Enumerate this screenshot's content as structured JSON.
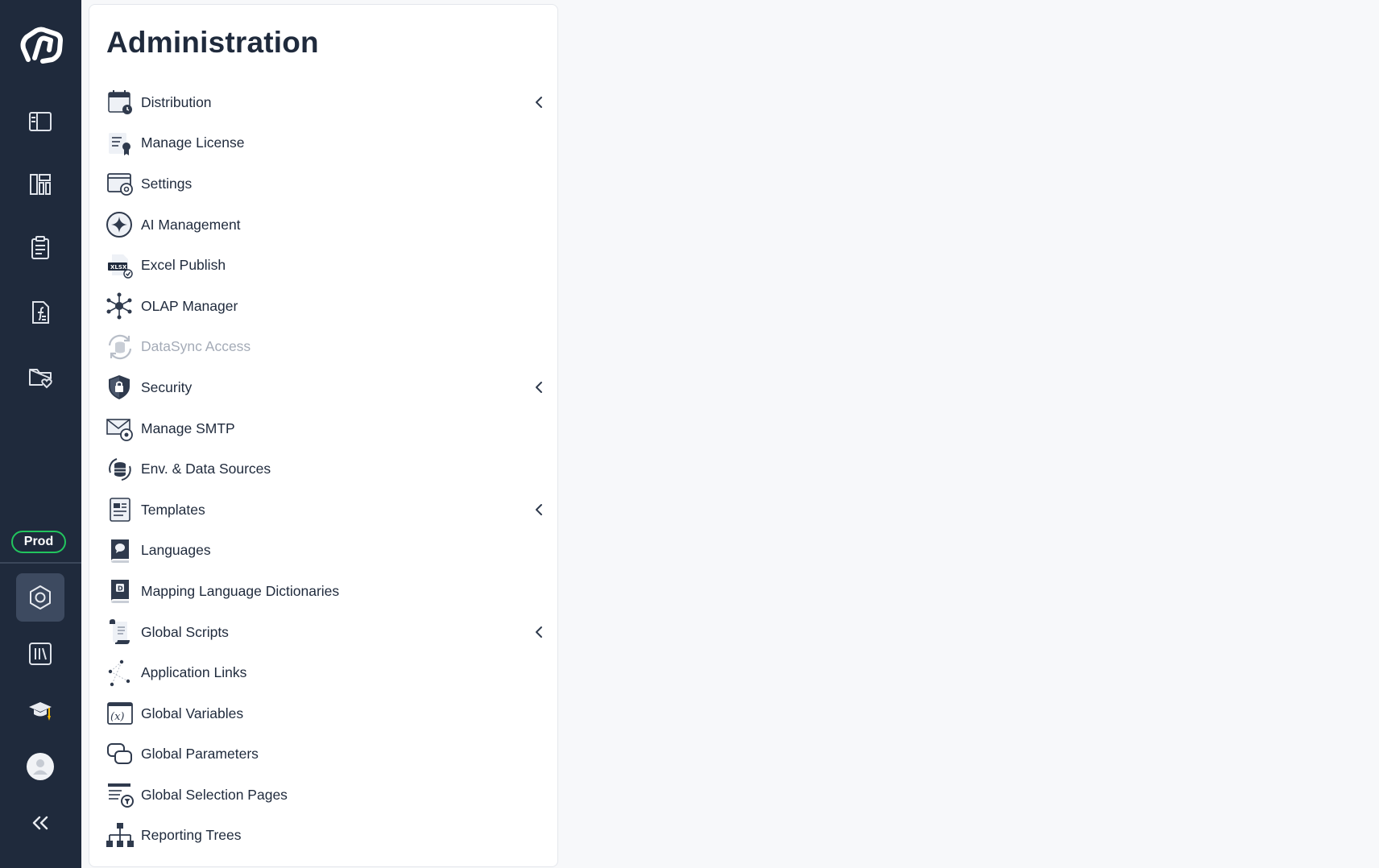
{
  "sidebar": {
    "env_badge": "Prod",
    "top_icons": [
      "logo-icon",
      "dashboard-panel-icon",
      "layout-icon",
      "clipboard-icon",
      "function-document-icon",
      "favorite-folder-icon"
    ],
    "bottom_icons": [
      "settings-hexagon-icon",
      "library-icon",
      "graduation-cap-icon",
      "user-avatar-icon",
      "collapse-chevrons-icon"
    ],
    "active": "settings-hexagon-icon",
    "colors": {
      "background": "#1f2a3c",
      "active": "#3d4a60",
      "badge_border": "#22c55e"
    }
  },
  "panel": {
    "title": "Administration",
    "items": [
      {
        "label": "Distribution",
        "icon": "calendar-clock-icon",
        "expandable": true,
        "enabled": true
      },
      {
        "label": "Manage License",
        "icon": "license-certificate-icon",
        "expandable": false,
        "enabled": true
      },
      {
        "label": "Settings",
        "icon": "window-gear-icon",
        "expandable": false,
        "enabled": true
      },
      {
        "label": "AI Management",
        "icon": "ai-star-icon",
        "expandable": false,
        "enabled": true
      },
      {
        "label": "Excel Publish",
        "icon": "xlsx-check-icon",
        "expandable": false,
        "enabled": true
      },
      {
        "label": "OLAP Manager",
        "icon": "olap-network-icon",
        "expandable": false,
        "enabled": true
      },
      {
        "label": "DataSync Access",
        "icon": "datasync-icon",
        "expandable": false,
        "enabled": false
      },
      {
        "label": "Security",
        "icon": "shield-lock-icon",
        "expandable": true,
        "enabled": true
      },
      {
        "label": "Manage SMTP",
        "icon": "mail-gear-icon",
        "expandable": false,
        "enabled": true
      },
      {
        "label": "Env. & Data Sources",
        "icon": "database-refresh-icon",
        "expandable": false,
        "enabled": true
      },
      {
        "label": "Templates",
        "icon": "template-document-icon",
        "expandable": true,
        "enabled": true
      },
      {
        "label": "Languages",
        "icon": "language-book-icon",
        "expandable": false,
        "enabled": true
      },
      {
        "label": "Mapping Language Dictionaries",
        "icon": "dictionary-book-icon",
        "expandable": false,
        "enabled": true
      },
      {
        "label": "Global Scripts",
        "icon": "script-scroll-icon",
        "expandable": true,
        "enabled": true
      },
      {
        "label": "Application Links",
        "icon": "links-nodes-icon",
        "expandable": false,
        "enabled": true
      },
      {
        "label": "Global Variables",
        "icon": "variable-x-icon",
        "expandable": false,
        "enabled": true
      },
      {
        "label": "Global Parameters",
        "icon": "parameters-chat-icon",
        "expandable": false,
        "enabled": true
      },
      {
        "label": "Global Selection Pages",
        "icon": "selection-filter-icon",
        "expandable": false,
        "enabled": true
      },
      {
        "label": "Reporting Trees",
        "icon": "org-tree-icon",
        "expandable": false,
        "enabled": true
      }
    ]
  }
}
